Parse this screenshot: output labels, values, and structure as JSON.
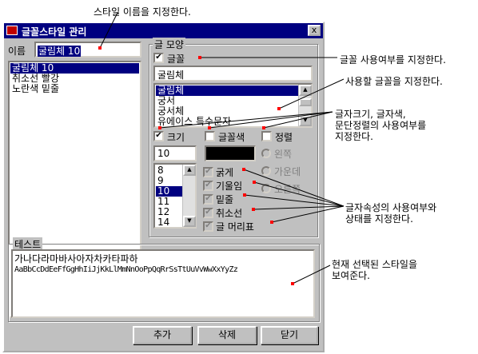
{
  "window": {
    "title": "글꼴스타일 관리",
    "close_label": "x"
  },
  "name_field": {
    "label": "이름",
    "value": "굴림체 10"
  },
  "style_list": [
    "굴림체 10",
    "취소선 빨강",
    "노란색 밑줄"
  ],
  "font_group": {
    "label": "글 모양",
    "font_check_label": "글꼴",
    "font_value": "굴림체",
    "font_list": [
      "굴림체",
      "궁서",
      "궁서체",
      "유에이스 특수문자"
    ],
    "size_label": "크기",
    "color_label": "글꼴색",
    "align_label": "정렬",
    "size_value": "10",
    "size_list": [
      "8",
      "9",
      "10",
      "11",
      "12",
      "14"
    ],
    "align_options": [
      "왼쪽",
      "가운데",
      "오른쪽"
    ],
    "attrs": [
      "굵게",
      "기울임",
      "밑줄",
      "취소선",
      "글 머리표"
    ]
  },
  "test_group": {
    "label": "테스트",
    "line1": "가나다라마바사아자차카타파하",
    "line2": "AaBbCcDdEeFfGgHhIiJjKkLlMmNnOoPpQqRrSsTtUuVvWwXxYyZz"
  },
  "buttons": {
    "add": "추가",
    "delete": "삭제",
    "close": "닫기"
  },
  "callouts": {
    "name": "스타일 이름을 지정한다.",
    "font_use": "글꼴 사용여부를 지정한다.",
    "font_select": "사용할 글꼴을 지정한다.",
    "size_color_1": "글자크기, 글자색,",
    "size_color_2": "문단정렬의 사용여부를",
    "size_color_3": "지정한다.",
    "attr_1": "글자속성의 사용여부와",
    "attr_2": "상태를 지정한다.",
    "test_1": "현재 선택된 스타일을",
    "test_2": "보여준다."
  },
  "colors": {
    "selection": "#000080",
    "callout_dot": "#ff0000",
    "swatch": "#000000"
  }
}
